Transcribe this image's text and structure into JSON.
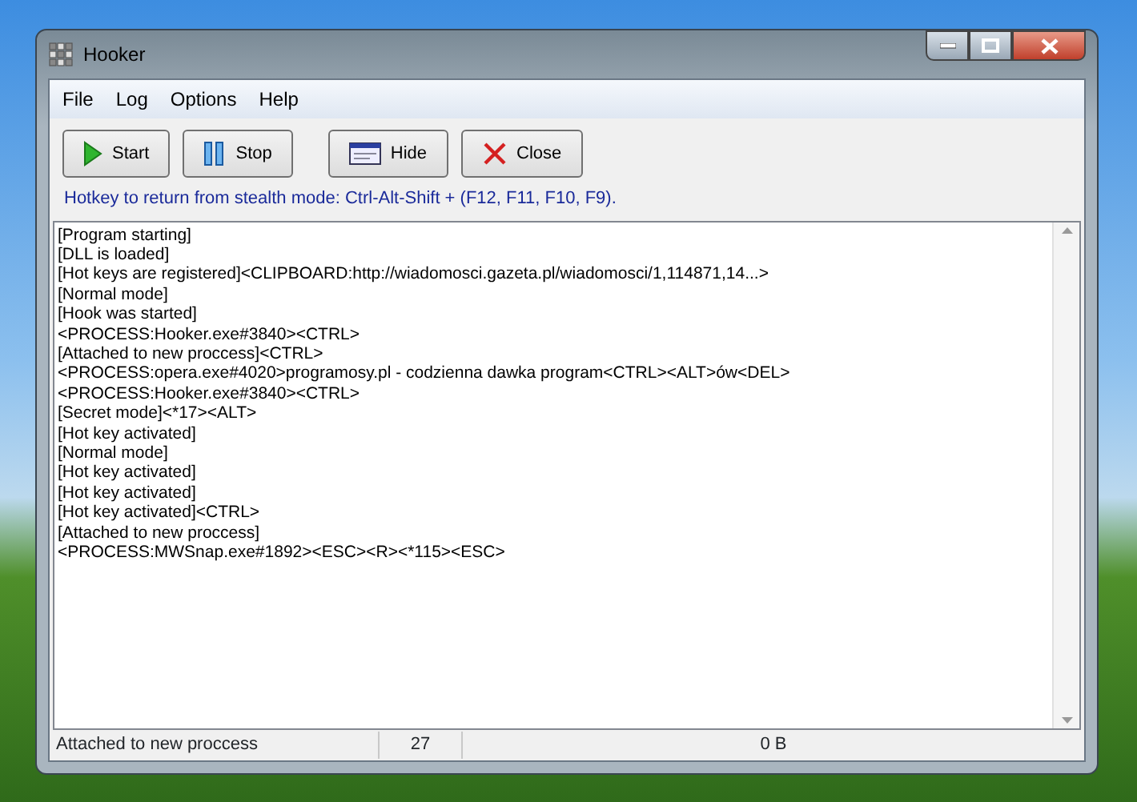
{
  "window": {
    "title": "Hooker"
  },
  "menu": [
    "File",
    "Log",
    "Options",
    "Help"
  ],
  "buttons": [
    {
      "label": "Start",
      "kind": "start"
    },
    {
      "label": "Stop",
      "kind": "stop"
    },
    {
      "label": "Hide",
      "kind": "hide"
    },
    {
      "label": "Close",
      "kind": "close"
    }
  ],
  "hint": "Hotkey to return from stealth mode: Ctrl-Alt-Shift + (F12, F11, F10, F9).",
  "log": [
    "[Program starting]",
    "[DLL is loaded]",
    "[Hot keys are registered]<CLIPBOARD:http://wiadomosci.gazeta.pl/wiadomosci/1,114871,14...>",
    "[Normal mode]",
    "[Hook was started]",
    "<PROCESS:Hooker.exe#3840><CTRL>",
    "[Attached to new proccess]<CTRL>",
    "<PROCESS:opera.exe#4020>programosy.pl - codzienna dawka program<CTRL><ALT>ów<DEL>",
    "<PROCESS:Hooker.exe#3840><CTRL>",
    "[Secret mode]<*17><ALT>",
    "[Hot key activated]",
    "[Normal mode]",
    "[Hot key activated]",
    "[Hot key activated]",
    "[Hot key activated]<CTRL>",
    "[Attached to new proccess]",
    "<PROCESS:MWSnap.exe#1892><ESC><R><*115><ESC>"
  ],
  "status_bar": [
    "Attached to new proccess",
    "27",
    "0 B"
  ]
}
